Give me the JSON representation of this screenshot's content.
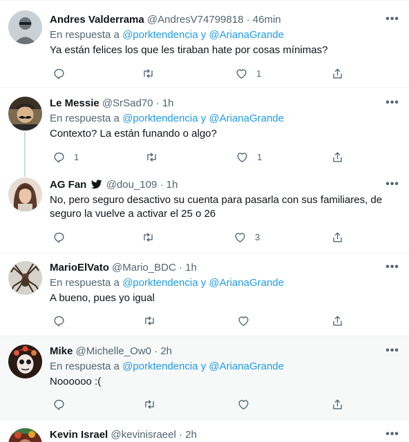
{
  "tweets": [
    {
      "name": "Andres Valderrama",
      "handle": "@AndresV74799818",
      "time": "46min",
      "reply_prefix": "En respuesta a",
      "reply_mentions": "@porktendencia y @ArianaGrande",
      "text": "Ya están felices los que les tiraban hate por cosas mínimas?",
      "reply_count": "",
      "retweet_count": "",
      "like_count": "1"
    },
    {
      "name": "Le Messie",
      "handle": "@SrSad70",
      "time": "1h",
      "reply_prefix": "En respuesta a",
      "reply_mentions": "@porktendencia y @ArianaGrande",
      "text": "Contexto? La están funando o algo?",
      "reply_count": "1",
      "retweet_count": "",
      "like_count": "1"
    },
    {
      "name": "AG Fan",
      "handle": "@dou_109",
      "time": "1h",
      "text": "No, pero seguro desactivo su cuenta para pasarla con sus familiares, de seguro la vuelve a activar el 25 o 26",
      "reply_count": "",
      "retweet_count": "",
      "like_count": "3"
    },
    {
      "name": "MarioElVato",
      "handle": "@Mario_BDC",
      "time": "1h",
      "reply_prefix": "En respuesta a",
      "reply_mentions": "@porktendencia y @ArianaGrande",
      "text": "A bueno, pues yo igual",
      "reply_count": "",
      "retweet_count": "",
      "like_count": ""
    },
    {
      "name": "Mike",
      "handle": "@Michelle_Ow0",
      "time": "2h",
      "reply_prefix": "En respuesta a",
      "reply_mentions": "@porktendencia y @ArianaGrande",
      "text": "Noooooo :(",
      "reply_count": "",
      "retweet_count": "",
      "like_count": ""
    },
    {
      "name": "Kevin Israel",
      "handle": "@kevinisraeel",
      "time": "2h"
    }
  ],
  "separator": "·",
  "more_glyph": "•••",
  "colors": {
    "link": "#1d9bf0",
    "muted": "#536471",
    "text": "#0f1419",
    "highlight_bg": "#f7f9f9"
  }
}
